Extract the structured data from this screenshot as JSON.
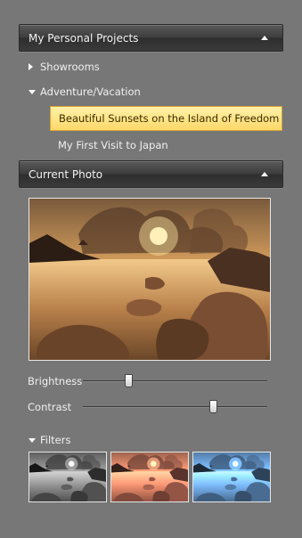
{
  "projects_panel": {
    "title": "My Personal Projects",
    "collapse_icon": "chevron-up-icon",
    "tree": [
      {
        "label": "Showrooms",
        "expanded": false
      },
      {
        "label": "Adventure/Vacation",
        "expanded": true,
        "children": [
          "Beautiful Sunsets on the Island of Freedom",
          "My First Visit to Japan"
        ]
      }
    ],
    "selected_item": "Beautiful Sunsets on the Island of Freedom"
  },
  "photo_panel": {
    "title": "Current Photo",
    "collapse_icon": "chevron-up-icon",
    "brightness": {
      "label": "Brightness",
      "value": 0.25
    },
    "contrast": {
      "label": "Contrast",
      "value": 0.71
    },
    "filters": {
      "label": "Filters",
      "thumbnails": [
        "grayscale",
        "sepia-vintage",
        "blue-tint"
      ]
    }
  },
  "colors": {
    "background": "#777777",
    "selection_fill": "#ffd86a",
    "selection_border": "#d6a53a"
  }
}
